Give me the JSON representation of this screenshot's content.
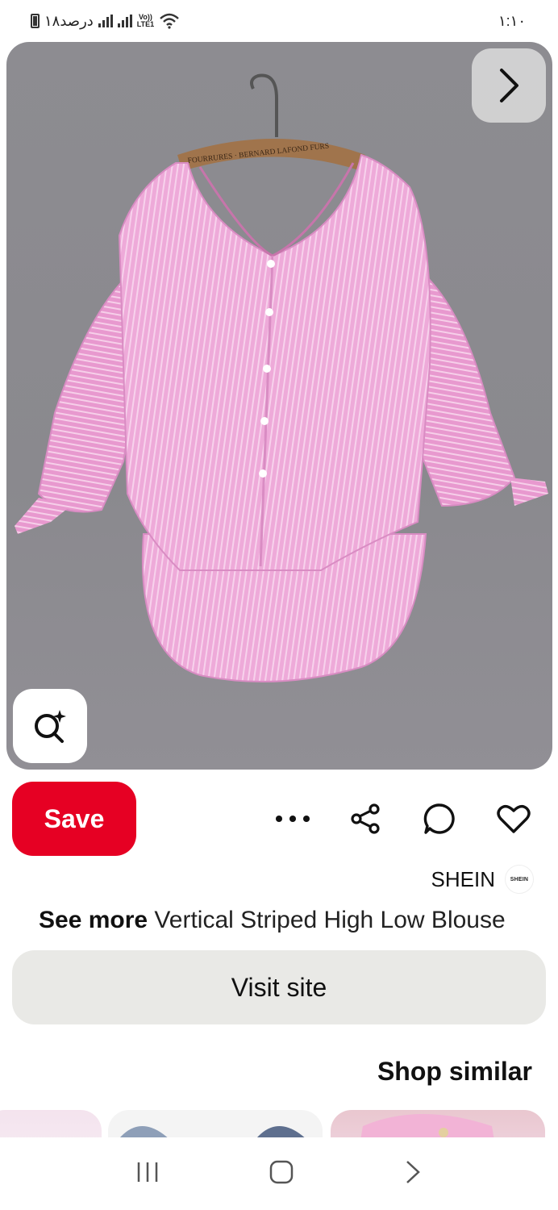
{
  "status_bar": {
    "time": "۱:۱۰",
    "battery_text": "۱۸درصد",
    "network": "LTE1"
  },
  "pin": {
    "hanger_label": "FOURRURES · BERNARD LAFOND FURS",
    "save_label": "Save",
    "brand": "SHEIN",
    "brand_logo_text": "SHEIN",
    "see_more_label": "See more",
    "title": "Vertical Striped High Low Blouse",
    "visit_label": "Visit site",
    "shop_similar_label": "Shop similar"
  },
  "icons": [
    "chevron-right-icon",
    "visual-search-icon",
    "more-icon",
    "share-icon",
    "comment-icon",
    "heart-icon",
    "recent-apps-icon",
    "home-icon",
    "back-icon"
  ],
  "colors": {
    "save": "#e60023",
    "visit_bg": "#e9e9e6",
    "blouse": "#eca1d5"
  }
}
